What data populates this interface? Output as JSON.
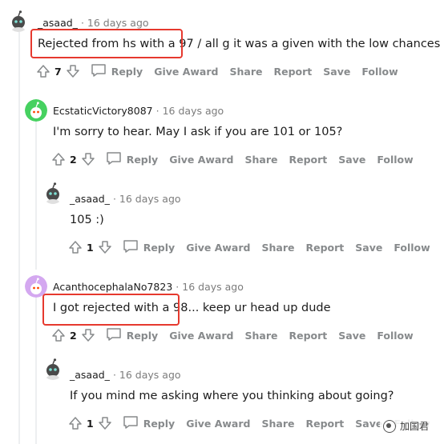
{
  "colors": {
    "highlight": "#e6392e",
    "meta": "#7c7c7c",
    "action": "#878a8c"
  },
  "comments": [
    {
      "user": "_asaad_",
      "sep": "·",
      "time": "16 days ago",
      "text": "Rejected from hs with a 97 / all g it was a given with the low chances",
      "score": "7",
      "avatar_icon": "snoo-avatar-icon"
    },
    {
      "user": "EcstaticVictory8087",
      "sep": "·",
      "time": "16 days ago",
      "text": "I'm sorry to hear. May I ask if you are 101 or 105?",
      "score": "2",
      "avatar_icon": "green-snoo-avatar-icon"
    },
    {
      "user": "_asaad_",
      "sep": "·",
      "time": "16 days ago",
      "text": "105 :)",
      "score": "1",
      "avatar_icon": "snoo-avatar-icon"
    },
    {
      "user": "AcanthocephalaNo7823",
      "sep": "·",
      "time": "16 days ago",
      "text": "I got rejected with a 98... keep ur head up dude",
      "score": "2",
      "avatar_icon": "purple-snoo-avatar-icon"
    },
    {
      "user": "_asaad_",
      "sep": "·",
      "time": "16 days ago",
      "text": "If you mind me asking where you thinking about going?",
      "score": "1",
      "avatar_icon": "snoo-avatar-icon"
    }
  ],
  "actions": {
    "reply": "Reply",
    "award": "Give Award",
    "share": "Share",
    "report": "Report",
    "save": "Save",
    "follow": "Follow"
  },
  "watermark": {
    "text": "加国君",
    "icon": "wechat-icon"
  }
}
